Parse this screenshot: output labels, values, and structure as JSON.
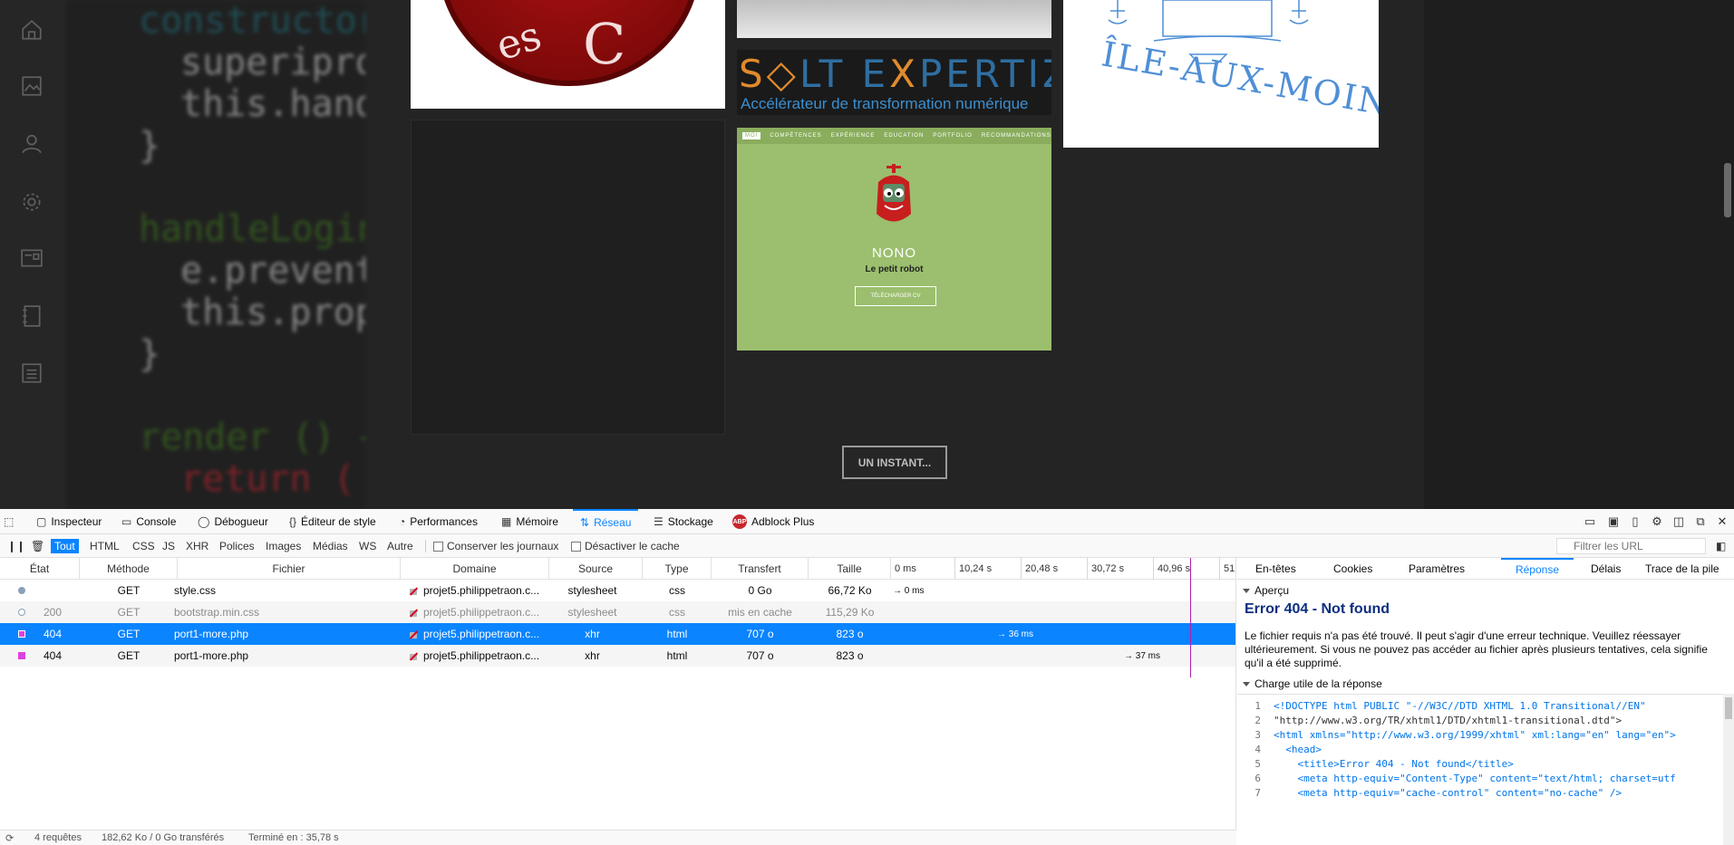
{
  "webpage": {
    "code_lines": [
      "constructor(",
      "superiprops)",
      "this.handle",
      "}",
      "",
      "handleLogin(loginObj, e) {",
      "e.preventDefault()",
      "this.props.loginAsync(loginObj",
      "}",
      "",
      "render () {",
      "return ("
    ],
    "tiles": {
      "chef_text_1": "es",
      "chef_text_2": "C",
      "solt_title_1": "S",
      "solt_title_o": "◇",
      "solt_title_2": "LT E",
      "solt_title_x": "X",
      "solt_title_3": "PERTIZ",
      "solt_subtitle": "Accélérateur de transformation numérique",
      "nono_nav": [
        "MOI",
        "COMPÉTENCES",
        "EXPÉRIENCE",
        "EDUCATION",
        "PORTFOLIO",
        "RECOMMANDATIONS"
      ],
      "nono_name": "NONO",
      "nono_subtitle": "Le petit robot",
      "nono_button": "TÉLÉCHARGER CV",
      "ile_text": "ÎLE-AUX-MOINES"
    },
    "load_more_button": "UN INSTANT..."
  },
  "devtools": {
    "tabs": [
      {
        "label": "Inspecteur",
        "icon": "inspector-icon"
      },
      {
        "label": "Console",
        "icon": "console-icon"
      },
      {
        "label": "Débogueur",
        "icon": "debugger-icon"
      },
      {
        "label": "Éditeur de style",
        "icon": "style-editor-icon"
      },
      {
        "label": "Performances",
        "icon": "performance-icon"
      },
      {
        "label": "Mémoire",
        "icon": "memory-icon"
      },
      {
        "label": "Réseau",
        "icon": "network-icon"
      },
      {
        "label": "Stockage",
        "icon": "storage-icon"
      },
      {
        "label": "Adblock Plus",
        "icon": "adblock-plus-icon"
      }
    ],
    "active_tab": "Réseau",
    "abp_badge": "ABP",
    "filters": [
      "Tout",
      "HTML",
      "CSS",
      "JS",
      "XHR",
      "Polices",
      "Images",
      "Médias",
      "WS",
      "Autre"
    ],
    "active_filter": "Tout",
    "persist_logs_label": "Conserver les journaux",
    "disable_cache_label": "Désactiver le cache",
    "url_filter_placeholder": "Filtrer les URL",
    "columns": [
      "État",
      "Méthode",
      "Fichier",
      "Domaine",
      "Source",
      "Type",
      "Transfert",
      "Taille"
    ],
    "timeline_ticks": [
      "0 ms",
      "10,24 s",
      "20,48 s",
      "30,72 s",
      "40,96 s",
      "51,"
    ],
    "requests": [
      {
        "status": "",
        "method": "GET",
        "file": "style.css",
        "domain": "projet5.philippetraon.c...",
        "source": "stylesheet",
        "type": "css",
        "transfer": "0 Go",
        "size": "66,72 Ko",
        "timing": "→ 0 ms",
        "state": "normal"
      },
      {
        "status": "200",
        "method": "GET",
        "file": "bootstrap.min.css",
        "domain": "projet5.philippetraon.c...",
        "source": "stylesheet",
        "type": "css",
        "transfer": "mis en cache",
        "size": "115,29 Ko",
        "timing": "",
        "state": "cached"
      },
      {
        "status": "404",
        "method": "GET",
        "file": "port1-more.php",
        "domain": "projet5.philippetraon.c...",
        "source": "xhr",
        "type": "html",
        "transfer": "707 o",
        "size": "823 o",
        "timing": "→ 36 ms",
        "state": "selected"
      },
      {
        "status": "404",
        "method": "GET",
        "file": "port1-more.php",
        "domain": "projet5.philippetraon.c...",
        "source": "xhr",
        "type": "html",
        "transfer": "707 o",
        "size": "823 o",
        "timing": "→ 37 ms",
        "state": "normal"
      }
    ],
    "status_bar": {
      "requests": "4 requêtes",
      "transferred": "182,62 Ko / 0 Go transférés",
      "finished": "Terminé en : 35,78 s"
    },
    "detail_tabs": [
      "En-têtes",
      "Cookies",
      "Paramètres",
      "Réponse",
      "Délais",
      "Trace de la pile"
    ],
    "active_detail_tab": "Réponse",
    "preview_label": "Aperçu",
    "error_title": "Error 404 - Not found",
    "error_body": "Le fichier requis n'a pas été trouvé. Il peut s'agir d'une erreur technique. Veuillez réessayer ultérieurement. Si vous ne pouvez pas accéder au fichier après plusieurs tentatives, cela signifie qu'il a été supprimé.",
    "payload_label": "Charge utile de la réponse",
    "payload_lines": [
      "<!DOCTYPE html PUBLIC \"-//W3C//DTD XHTML 1.0 Transitional//EN\"",
      "\"http://www.w3.org/TR/xhtml1/DTD/xhtml1-transitional.dtd\">",
      "<html xmlns=\"http://www.w3.org/1999/xhtml\" xml:lang=\"en\" lang=\"en\">",
      "  <head>",
      "    <title>Error 404 - Not found</title>",
      "    <meta http-equiv=\"Content-Type\" content=\"text/html; charset=utf",
      "    <meta http-equiv=\"cache-control\" content=\"no-cache\" />"
    ]
  },
  "colors": {
    "accent": "#0a84ff",
    "error_title": "#0c2f80",
    "status_404_marker": "#e041e0"
  }
}
